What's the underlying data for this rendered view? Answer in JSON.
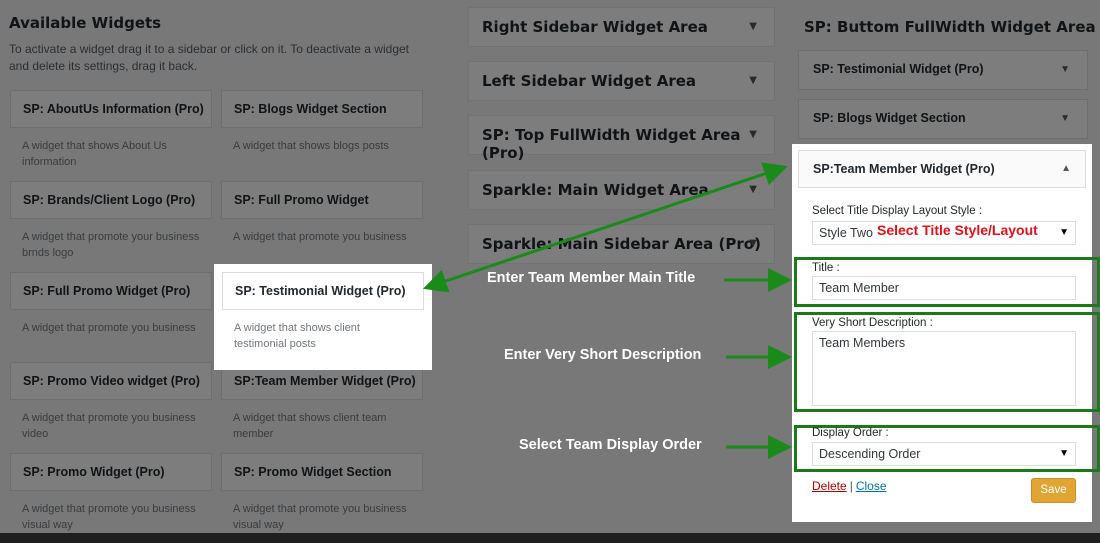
{
  "available": {
    "title": "Available Widgets",
    "description": "To activate a widget drag it to a sidebar or click on it. To deactivate a widget and delete its settings, drag it back.",
    "widgets": [
      {
        "title": "SP: AboutUs Information (Pro)",
        "desc": "A widget that shows About Us information"
      },
      {
        "title": "SP: Blogs Widget Section",
        "desc": "A widget that shows blogs posts"
      },
      {
        "title": "SP: Brands/Client Logo (Pro)",
        "desc": "A widget that promote your business brnds logo"
      },
      {
        "title": "SP: Full Promo Widget",
        "desc": "A widget that promote you business"
      },
      {
        "title": "SP: Full Promo Widget (Pro)",
        "desc": "A widget that promote you business"
      },
      {
        "title": "SP: Testimonial Widget (Pro)",
        "desc": "A widget that shows client testimonial posts"
      },
      {
        "title": "SP: Promo Video widget (Pro)",
        "desc": "A widget that promote you business video"
      },
      {
        "title": "SP:Team Member Widget (Pro)",
        "desc": "A widget that shows client team member"
      },
      {
        "title": "SP: Promo Widget (Pro)",
        "desc": "A widget that promote you business visual way"
      },
      {
        "title": "SP: Promo Widget Section",
        "desc": "A widget that promote you business visual way"
      }
    ]
  },
  "areas": [
    "Right Sidebar Widget Area",
    "Left Sidebar Widget Area",
    "SP: Top FullWidth Widget Area (Pro)",
    "Sparkle: Main Widget Area",
    "Sparkle: Main Sidebar Area (Pro)"
  ],
  "right_area": {
    "title": "SP: Buttom FullWidth Widget Area (Prộ)",
    "widgets": [
      "SP: Testimonial Widget (Pro)",
      "SP: Blogs Widget Section"
    ],
    "open_widget": {
      "title": "SP:Team Member Widget (Pro)",
      "layout_label": "Select Title Display Layout Style :",
      "layout_value": "Style Two",
      "title_label": "Title :",
      "title_value": "Team Member",
      "desc_label": "Very Short Description :",
      "desc_value": "Team Members",
      "order_label": "Display Order :",
      "order_value": "Descending Order",
      "delete_label": "Delete",
      "separator": "|",
      "close_label": "Close",
      "save_label": "Save"
    }
  },
  "annotations": {
    "layout": "Select Title Style/Layout",
    "title": "Enter Team Member Main Title",
    "desc": "Enter Very Short Description",
    "order": "Select Team Display Order"
  },
  "colors": {
    "accent_green": "#1a8a1a",
    "annotation_red": "#e0101a",
    "save_button": "#e0a533"
  }
}
